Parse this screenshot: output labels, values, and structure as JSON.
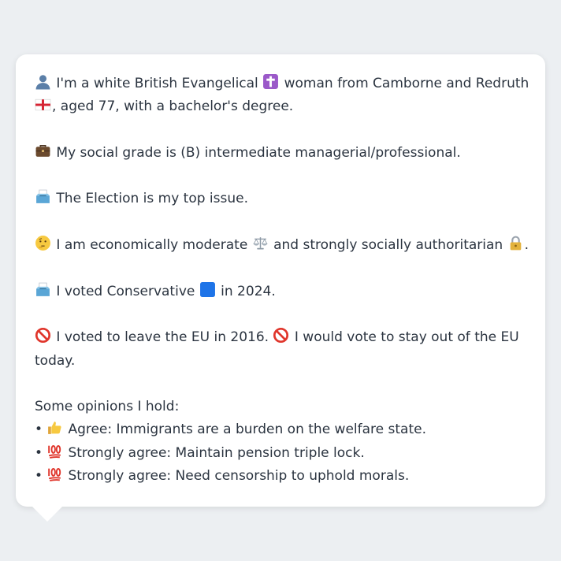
{
  "persona": {
    "intro": {
      "icon": "person-silhouette-icon",
      "part1": "I'm a white British Evangelical",
      "icon2": "latin-cross-icon",
      "part2": "woman from Camborne and Redruth",
      "icon3": "england-flag-icon",
      "part3": ", aged 77, with a bachelor's degree."
    },
    "social_grade": {
      "icon": "briefcase-icon",
      "text": "My social grade is (B) intermediate managerial/professional."
    },
    "top_issue": {
      "icon": "ballot-box-icon",
      "text": "The Election is my top issue."
    },
    "ideology": {
      "icon": "thinking-face-icon",
      "part1": "I am economically moderate",
      "icon2": "balance-scale-icon",
      "part2": "and strongly socially authoritarian",
      "icon3": "padlock-icon",
      "part3": "."
    },
    "vote_2024": {
      "icon": "ballot-box-icon",
      "part1": "I voted Conservative",
      "icon2": "blue-square-icon",
      "part2": "in 2024."
    },
    "brexit": {
      "icon": "prohibited-icon",
      "part1": "I voted to leave the EU in 2016.",
      "icon2": "prohibited-icon",
      "part2": "I would vote to stay out of the EU today."
    },
    "opinions": {
      "heading": "Some opinions I hold:",
      "items": [
        {
          "bullet": "•",
          "icon": "thumbs-up-icon",
          "text": "Agree: Immigrants are a burden on the welfare state."
        },
        {
          "bullet": "•",
          "icon": "hundred-points-icon",
          "text": "Strongly agree: Maintain pension triple lock."
        },
        {
          "bullet": "•",
          "icon": "hundred-points-icon",
          "text": "Strongly agree: Need censorship to uphold morals."
        }
      ]
    }
  },
  "colors": {
    "background": "#eceff2",
    "card": "#ffffff",
    "text": "#2b3440",
    "conservative_blue": "#1e74e8"
  }
}
